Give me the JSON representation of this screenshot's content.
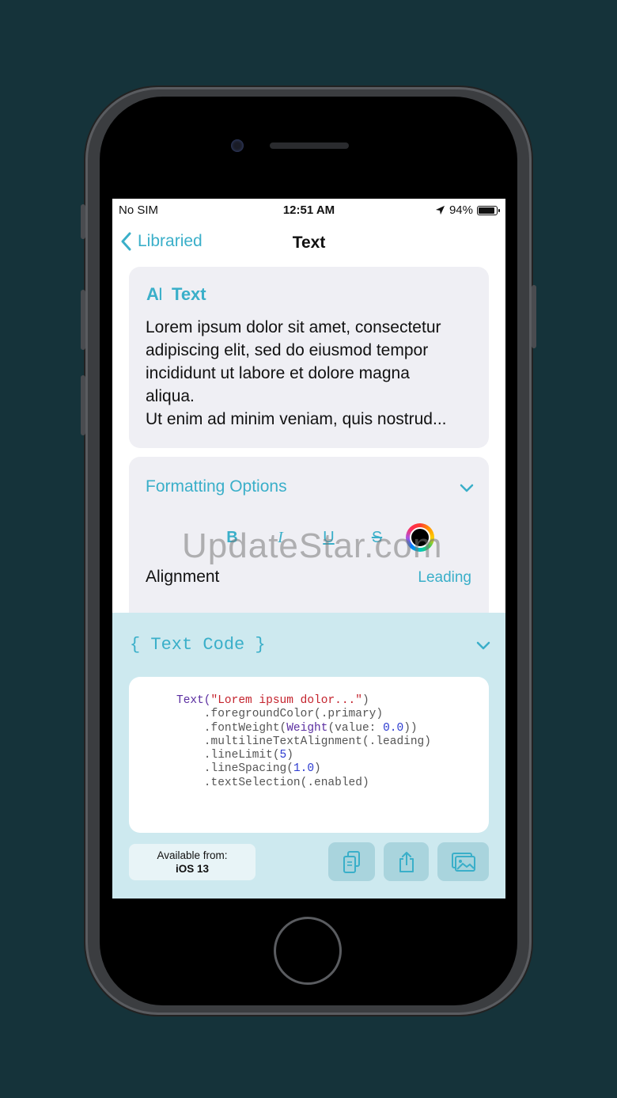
{
  "status_bar": {
    "carrier": "No SIM",
    "time": "12:51 AM",
    "battery": "94%"
  },
  "nav": {
    "back_label": "Libraried",
    "title": "Text"
  },
  "text_card": {
    "header": "Text",
    "lines": [
      "Lorem ipsum dolor sit amet, consectetur",
      "adipiscing elit, sed do eiusmod tempor",
      "incididunt ut labore et dolore magna",
      "aliqua.",
      "Ut enim ad minim veniam, quis nostrud..."
    ]
  },
  "formatting": {
    "header": "Formatting Options",
    "bold": "B",
    "italic": "I",
    "underline": "U",
    "strike": "S",
    "alignment_label": "Alignment",
    "alignment_value": "Leading"
  },
  "watermark": "UpdateStar.com",
  "code_section": {
    "header": "{ Text Code }",
    "lines": [
      [
        {
          "t": "Text(",
          "c": "kw"
        },
        {
          "t": "\"Lorem ipsum dolor...\"",
          "c": "str"
        },
        {
          "t": ")",
          "c": ""
        }
      ],
      [
        {
          "t": "    .foregroundColor(.primary)",
          "c": ""
        }
      ],
      [
        {
          "t": "    .fontWeight(",
          "c": ""
        },
        {
          "t": "Weight",
          "c": "kw"
        },
        {
          "t": "(value: ",
          "c": ""
        },
        {
          "t": "0.0",
          "c": "num"
        },
        {
          "t": "))",
          "c": ""
        }
      ],
      [
        {
          "t": "    .multilineTextAlignment(.leading)",
          "c": ""
        }
      ],
      [
        {
          "t": "    .lineLimit(",
          "c": ""
        },
        {
          "t": "5",
          "c": "num"
        },
        {
          "t": ")",
          "c": ""
        }
      ],
      [
        {
          "t": "    .lineSpacing(",
          "c": ""
        },
        {
          "t": "1.0",
          "c": "num"
        },
        {
          "t": ")",
          "c": ""
        }
      ],
      [
        {
          "t": "    .textSelection(.enabled)",
          "c": ""
        }
      ]
    ],
    "available_label": "Available from:",
    "available_version": "iOS 13"
  },
  "colors": {
    "accent": "#3aafc9",
    "panel": "#cde9ef",
    "card": "#efeff4"
  }
}
